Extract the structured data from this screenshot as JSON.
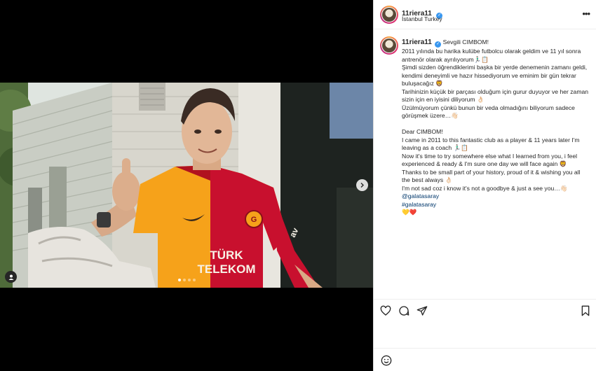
{
  "post": {
    "username": "11riera11",
    "location": "İstanbul Turkey",
    "photo_text": {
      "sponsor_line1": "TÜRK",
      "sponsor_line2": "TELEKOM",
      "sleeve": "av"
    },
    "carousel": {
      "count": 4,
      "active_index": 0
    }
  },
  "caption": {
    "username": "11riera11",
    "line1": "Sevgili CIMBOM!",
    "tr_p1": "2011 yılında bu harika kulübe futbolcu olarak geldim ve 11 yıl sonra antrenör olarak ayrılıyorum🏃🏻‍♂️📋",
    "tr_p2": "Şimdi sizden öğrendiklerimi başka bir yerde denemenin zamanı geldi, kendimi deneyimli ve hazır hissediyorum ve eminim bir gün tekrar buluşacağız 🦁",
    "tr_p3": "Tarihinizin küçük bir parçası olduğum için gurur duyuyor ve her zaman sizin için en iyisini diliyorum 👌🏻",
    "tr_p4": "Üzülmüyorum çünkü bunun bir veda olmadığını biliyorum sadece görüşmek üzere…👋🏻",
    "en_p0": "Dear CIMBOM!",
    "en_p1": "I came in 2011 to this fantastic club as a player & 11 years later I'm leaving as a coach 🏃🏻‍♂️📋",
    "en_p2": "Now it's time to try somewhere else what I learned from you, i feel experienced & ready & I'm sure one day we will face again 🦁",
    "en_p3": "Thanks to be small part of your history, proud of it & wishing you all the best always 👌🏻",
    "en_p4": "I'm not sad coz i know it's not a goodbye & just a see you…👋🏻",
    "mention": "@galatasaray",
    "hashtag": "#galatasaray",
    "hearts": "💛❤️"
  },
  "colors": {
    "galatasaray_yellow": "#f6a21a",
    "galatasaray_red": "#c8102e",
    "verified_blue": "#3897f0",
    "link_blue": "#00376b"
  },
  "icons": [
    "verified-badge-icon",
    "more-options-icon",
    "heart-icon",
    "comment-icon",
    "share-icon",
    "bookmark-icon",
    "emoji-icon",
    "chevron-right-icon",
    "user-tag-icon"
  ]
}
